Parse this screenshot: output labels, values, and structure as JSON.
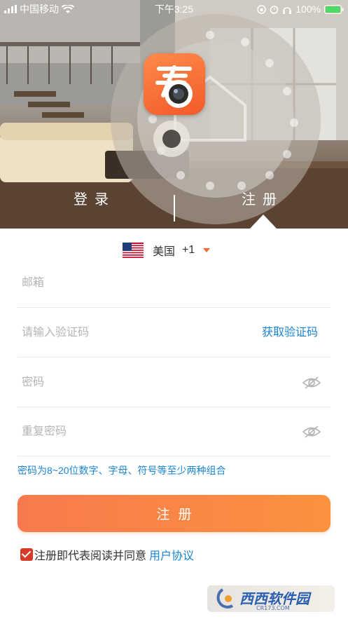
{
  "status_bar": {
    "carrier": "中国移动",
    "time": "下午3:25",
    "battery": "100%"
  },
  "logo": {
    "glyph": "看"
  },
  "tabs": {
    "login": "登录",
    "register": "注册",
    "active": "register"
  },
  "country": {
    "name": "美国",
    "code": "+1"
  },
  "form": {
    "email_placeholder": "邮箱",
    "code_placeholder": "请输入验证码",
    "get_code_label": "获取验证码",
    "password_placeholder": "密码",
    "repeat_password_placeholder": "重复密码",
    "password_hint": "密码为8~20位数字、字母、符号等至少两种组合",
    "submit_label": "注册",
    "agree_text": "注册即代表阅读并同意",
    "agree_link": "用户协议",
    "agree_checked": true
  },
  "watermark": {
    "title": "西西软件园",
    "url": "CR173.COM"
  },
  "colors": {
    "accent": "#f77a4e",
    "link": "#1a84d6",
    "checkbox": "#d83a2a"
  }
}
